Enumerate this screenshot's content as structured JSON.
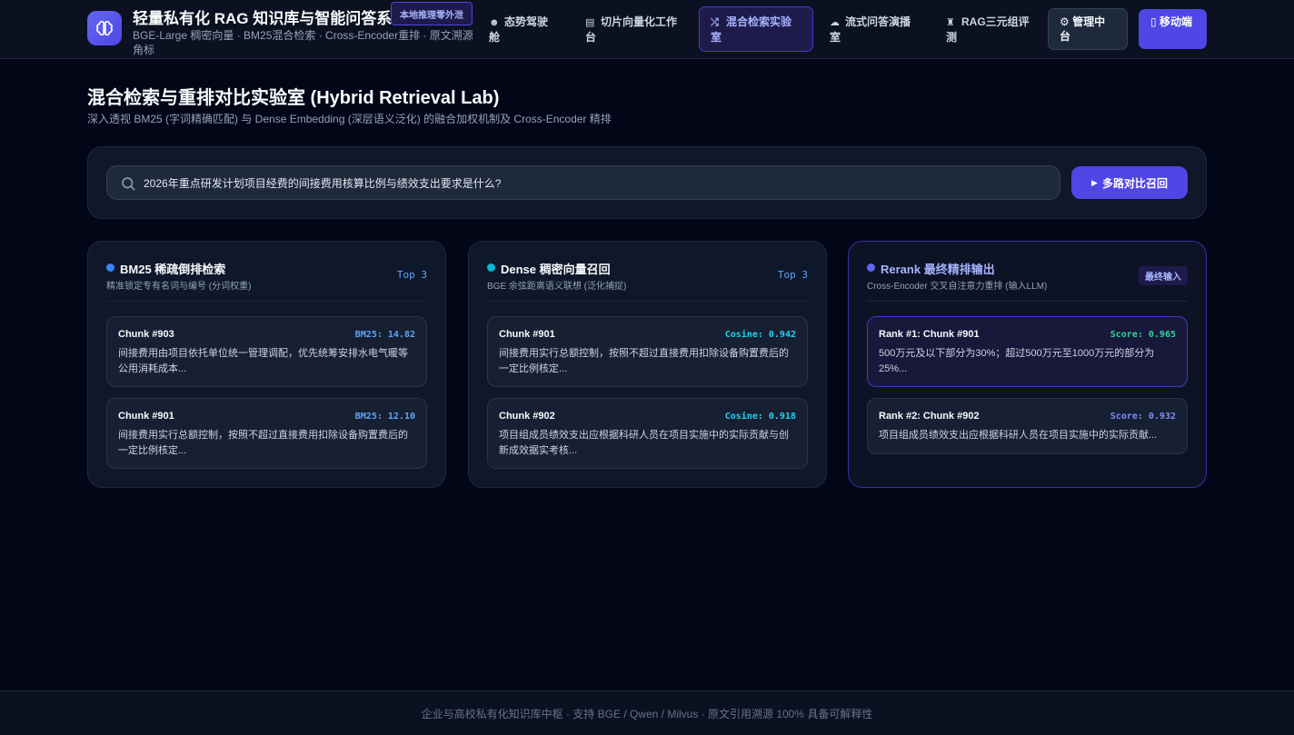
{
  "header": {
    "title": "轻量私有化 RAG 知识库与智能问答系统",
    "badge": "本地推理零外泄",
    "subtitle": "BGE-Large 稠密向量 · BM25混合检索 · Cross-Encoder重排 · 原文溯源角标",
    "nav": [
      {
        "icon": "☻",
        "label": "态势驾驶舱"
      },
      {
        "icon": "▤",
        "label": "切片向量化工作台"
      },
      {
        "icon": "⤮",
        "label": "混合检索实验室"
      },
      {
        "icon": "☁",
        "label": "流式问答演播室"
      },
      {
        "icon": "♜",
        "label": "RAG三元组评测"
      }
    ],
    "admin_icon": "⚙",
    "admin_label": "管理中台",
    "mobile_icon": "▯",
    "mobile_label": "移动端"
  },
  "page": {
    "title": "混合检索与重排对比实验室 (Hybrid Retrieval Lab)",
    "subtitle": "深入透视 BM25 (字词精确匹配) 与 Dense Embedding (深层语义泛化) 的融合加权机制及 Cross-Encoder 精排"
  },
  "search": {
    "query": "2026年重点研发计划项目经费的间接费用核算比例与绩效支出要求是什么?",
    "button_label": "多路对比召回"
  },
  "columns": [
    {
      "title": "BM25 稀疏倒排检索",
      "subtitle": "精准锁定专有名词与编号 (分词权重)",
      "tag": "Top 3",
      "dot_color": "#3b82f6",
      "title_color": "#f8fafc",
      "cards": [
        {
          "title": "Chunk #903",
          "score": "BM25: 14.82",
          "score_color": "#60a5fa",
          "text": "间接费用由项目依托单位统一管理调配，优先统筹安排水电气暖等公用消耗成本..."
        },
        {
          "title": "Chunk #901",
          "score": "BM25: 12.10",
          "score_color": "#60a5fa",
          "text": "间接费用实行总额控制，按照不超过直接费用扣除设备购置费后的一定比例核定..."
        }
      ]
    },
    {
      "title": "Dense 稠密向量召回",
      "subtitle": "BGE 余弦距离语义联想 (泛化捕捉)",
      "tag": "Top 3",
      "dot_color": "#06b6d4",
      "title_color": "#f8fafc",
      "cards": [
        {
          "title": "Chunk #901",
          "score": "Cosine: 0.942",
          "score_color": "#22d3ee",
          "text": "间接费用实行总额控制，按照不超过直接费用扣除设备购置费后的一定比例核定..."
        },
        {
          "title": "Chunk #902",
          "score": "Cosine: 0.918",
          "score_color": "#22d3ee",
          "text": "项目组成员绩效支出应根据科研人员在项目实施中的实际贡献与创新成效据实考核..."
        }
      ]
    },
    {
      "title": "Rerank 最终精排输出",
      "subtitle": "Cross-Encoder 交叉自注意力重排 (输入LLM)",
      "tag": "最终输入",
      "dot_color": "#6366f1",
      "title_color": "#a5b4fc",
      "cards": [
        {
          "title": "Rank #1: Chunk #901",
          "score": "Score: 0.965",
          "score_color": "#34d399",
          "text": "500万元及以下部分为30%；超过500万元至1000万元的部分为25%..."
        },
        {
          "title": "Rank #2: Chunk #902",
          "score": "Score: 0.932",
          "score_color": "#818cf8",
          "text": "项目组成员绩效支出应根据科研人员在项目实施中的实际贡献..."
        }
      ]
    }
  ],
  "footer": {
    "text": "企业与高校私有化知识库中枢 · 支持 BGE / Qwen / Milvus · 原文引用溯源 100% 具备可解释性"
  }
}
